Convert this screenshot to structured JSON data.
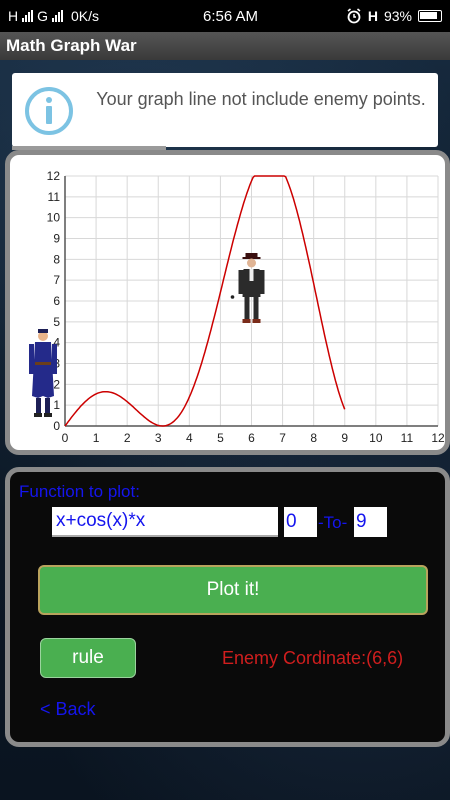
{
  "status_bar": {
    "left_signal_1": "H",
    "left_signal_2": "G",
    "speed": "0K/s",
    "time": "6:56 AM",
    "right_net": "H",
    "battery": "93%"
  },
  "app": {
    "title": "Math Graph War"
  },
  "info": {
    "message": "Your graph line not include enemy points.",
    "icon": "info-icon"
  },
  "chart_data": {
    "type": "line",
    "title": "",
    "xlabel": "",
    "ylabel": "",
    "xlim": [
      0,
      12
    ],
    "ylim": [
      0,
      12
    ],
    "x_ticks": [
      "0",
      "1",
      "2",
      "3",
      "4",
      "5",
      "6",
      "7",
      "8",
      "9",
      "10",
      "11",
      "12"
    ],
    "y_ticks": [
      "0",
      "1",
      "2",
      "3",
      "4",
      "5",
      "6",
      "7",
      "8",
      "9",
      "10",
      "11",
      "12"
    ],
    "grid": true,
    "series": [
      {
        "x": [
          0,
          0.5,
          1,
          1.5,
          2,
          2.5,
          3,
          3.5,
          4,
          4.5,
          5,
          5.5,
          6,
          6.5,
          7,
          7.5,
          8,
          8.5,
          9
        ],
        "y": [
          0,
          0.94,
          1.54,
          1.61,
          1.17,
          0.5,
          0.03,
          0.23,
          1.39,
          3.54,
          6.42,
          9.49,
          11.76,
          12.0,
          12.0,
          9.78,
          6.84,
          3.89,
          0.8
        ],
        "color": "#cc0000"
      }
    ],
    "characters": [
      {
        "role": "player",
        "x": 0,
        "y": 0
      },
      {
        "role": "enemy",
        "x": 6,
        "y": 6
      }
    ]
  },
  "controls": {
    "function_label": "Function to plot:",
    "function_value": "x+cos(x)*x",
    "from_value": "0",
    "to_label": "-To-",
    "to_value": "9",
    "plot_button": "Plot it!",
    "rule_button": "rule",
    "enemy_coordinate": "Enemy Cordinate:(6,6)",
    "back_link": "< Back"
  },
  "colors": {
    "accent_green": "#4aaf50",
    "text_blue": "#1515ee",
    "enemy_red": "#d01e1e"
  }
}
